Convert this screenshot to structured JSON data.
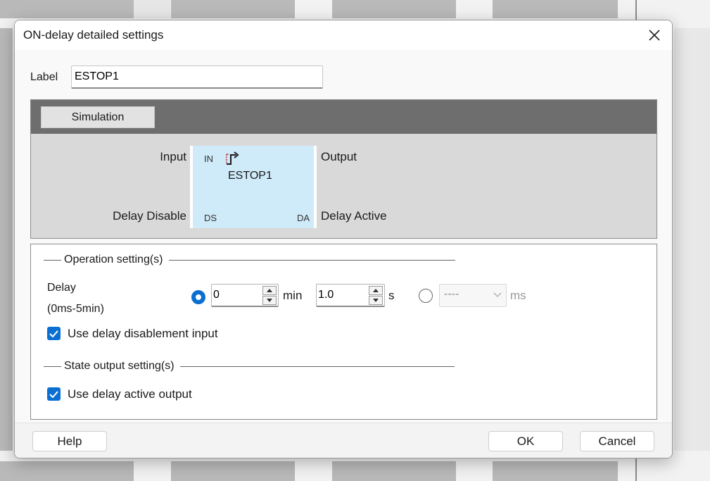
{
  "dialog": {
    "title": "ON-delay detailed settings",
    "label_caption": "Label",
    "label_value": "ESTOP1"
  },
  "simulation": {
    "tab_label": "Simulation",
    "block_name": "ESTOP1",
    "pins": {
      "in": "IN",
      "ds": "DS",
      "da": "DA"
    },
    "ports": {
      "input": "Input",
      "output": "Output",
      "delay_disable": "Delay Disable",
      "delay_active": "Delay Active"
    },
    "block_icon": "on-delay-icon"
  },
  "operation": {
    "heading": "Operation setting(s)",
    "delay_label": "Delay",
    "delay_range": "(0ms-5min)",
    "min_value": "0",
    "min_unit": "min",
    "sec_value": "1.0",
    "sec_unit": "s",
    "ms_value": "----",
    "ms_unit": "ms",
    "selected_mode": "min-s",
    "use_delay_disablement_label": "Use delay disablement input",
    "use_delay_disablement_checked": true
  },
  "state_output": {
    "heading": "State output setting(s)",
    "use_delay_active_label": "Use delay active output",
    "use_delay_active_checked": true
  },
  "footer": {
    "help": "Help",
    "ok": "OK",
    "cancel": "Cancel"
  },
  "colors": {
    "accent": "#0b6fd1",
    "pin": "#c0282d",
    "block": "#cfeaf8",
    "sim_header": "#6e6e6e"
  }
}
